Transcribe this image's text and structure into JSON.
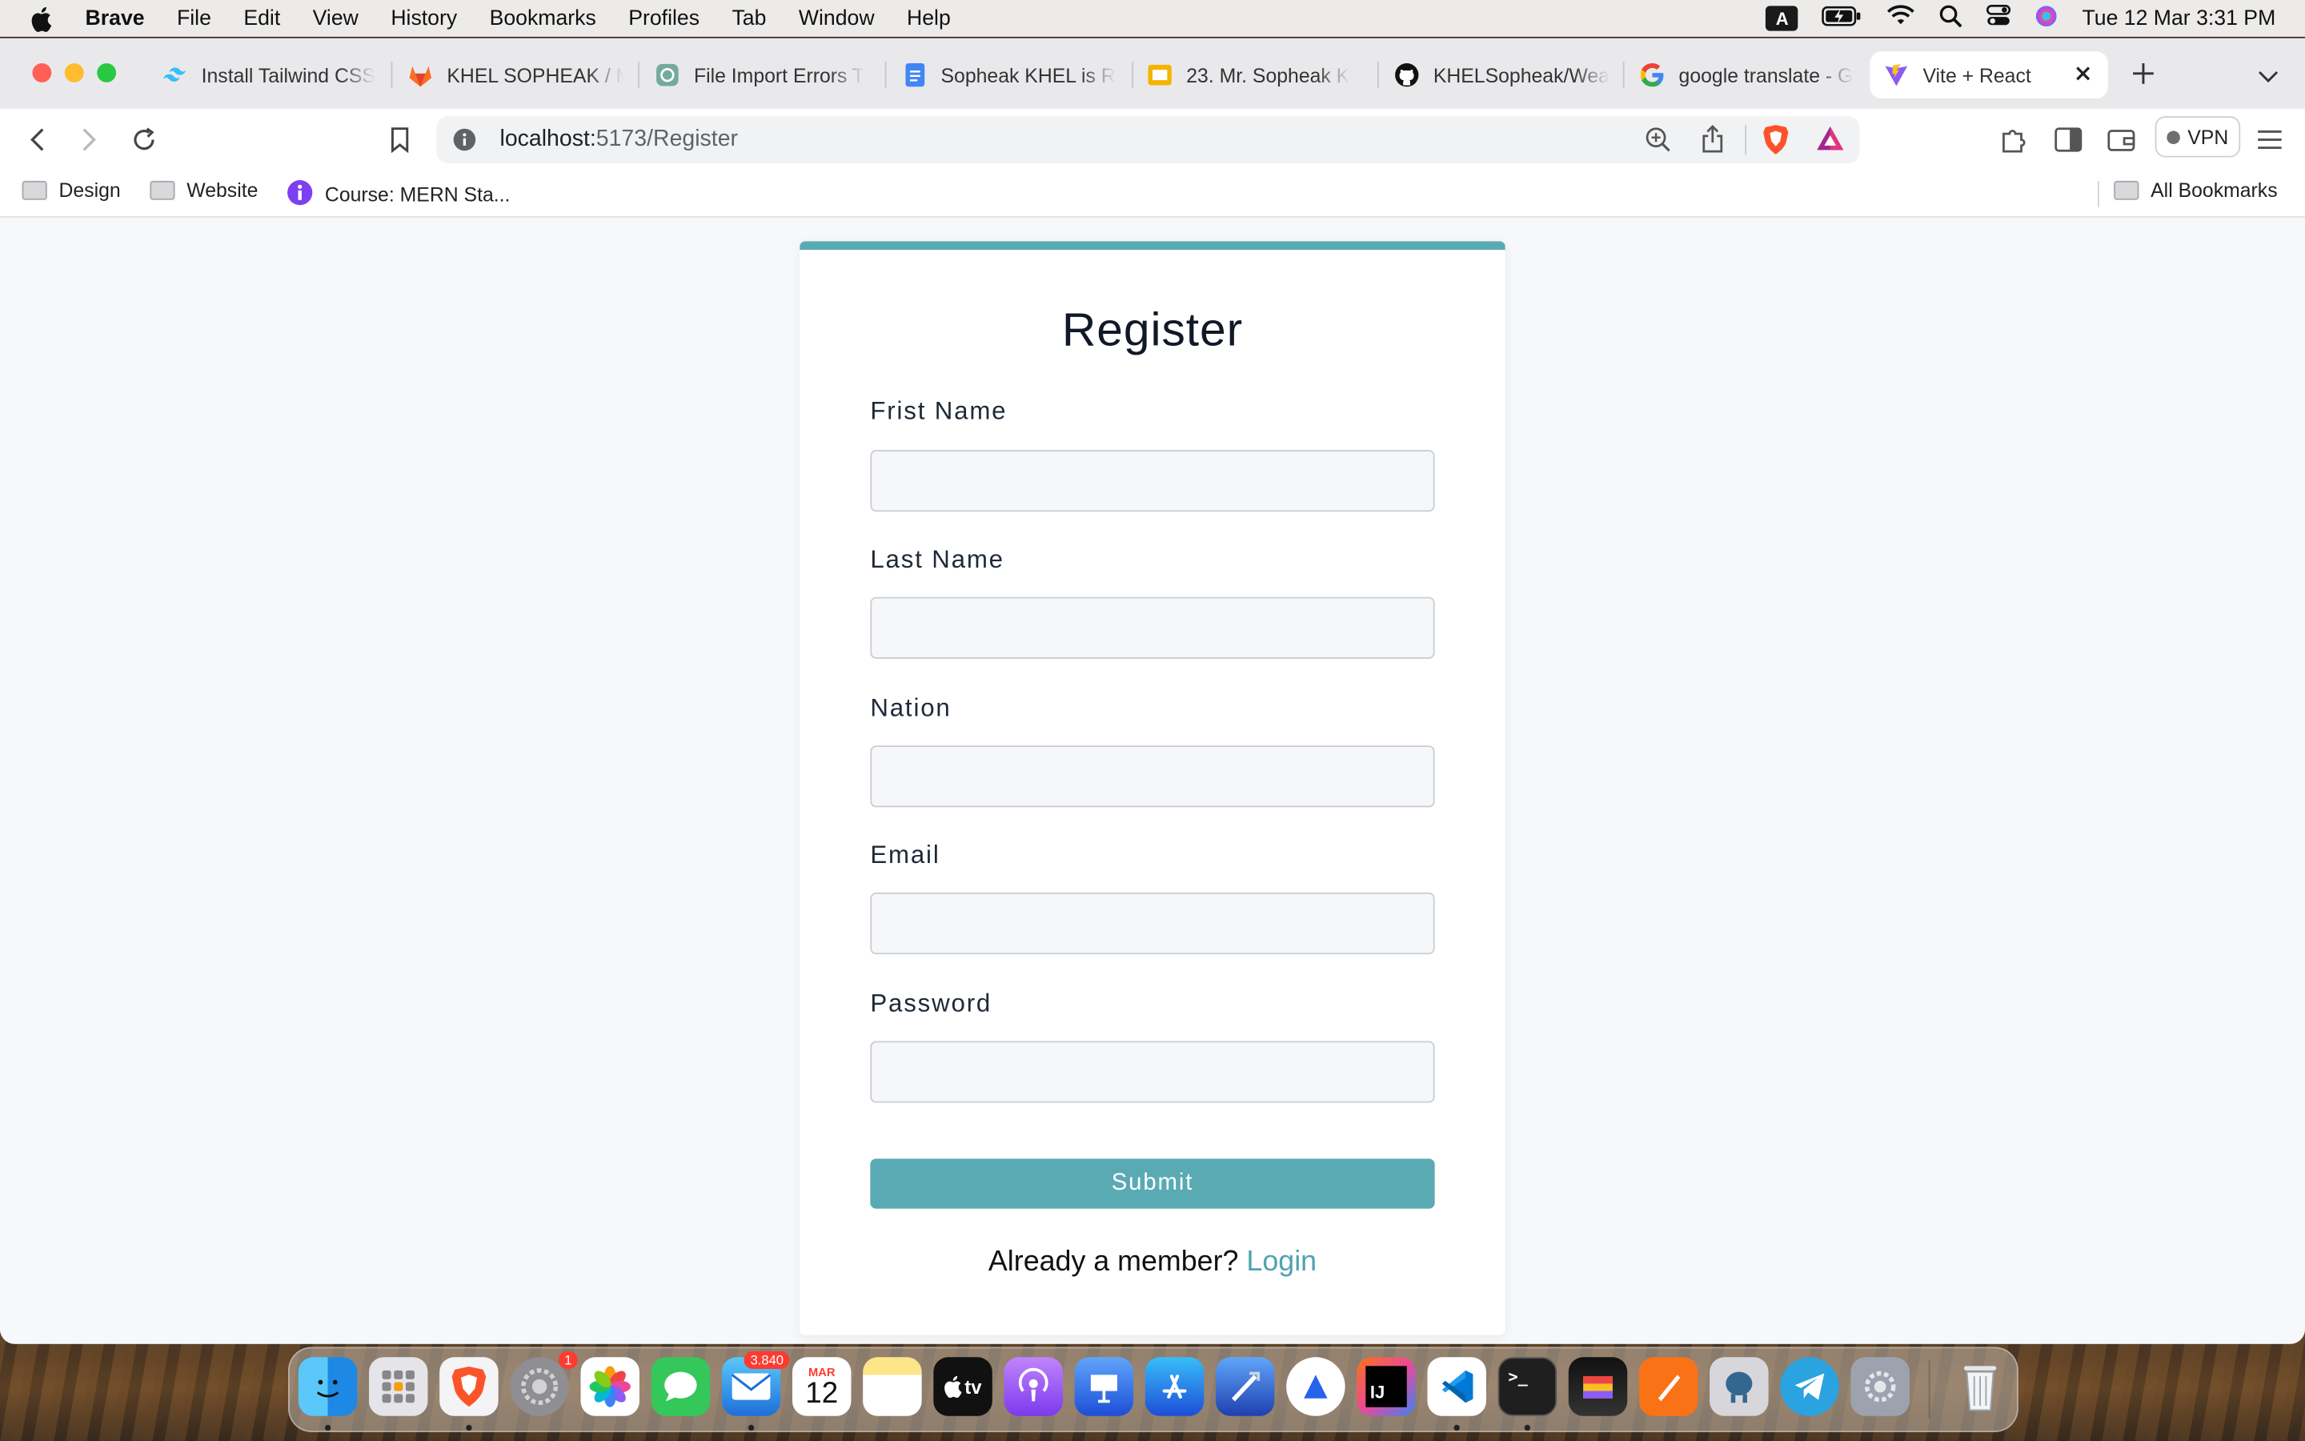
{
  "menubar": {
    "app": "Brave",
    "items": [
      "File",
      "Edit",
      "View",
      "History",
      "Bookmarks",
      "Profiles",
      "Tab",
      "Window",
      "Help"
    ],
    "input_source": "A",
    "clock": "Tue 12 Mar  3:31 PM"
  },
  "tabs": [
    {
      "title": "Install Tailwind CSS",
      "icon": "tailwind-icon"
    },
    {
      "title": "KHEL SOPHEAK / M",
      "icon": "gitlab-icon"
    },
    {
      "title": "File Import Errors T",
      "icon": "chatgpt-icon"
    },
    {
      "title": "Sopheak KHEL is R",
      "icon": "google-docs-icon"
    },
    {
      "title": "23. Mr. Sopheak K",
      "icon": "google-slides-icon"
    },
    {
      "title": "KHELSopheak/Wea",
      "icon": "github-icon"
    },
    {
      "title": "google translate - G",
      "icon": "google-icon"
    },
    {
      "title": "Vite + React",
      "icon": "vite-icon",
      "active": true
    }
  ],
  "address": {
    "host": "localhost:",
    "path": "5173/Register"
  },
  "vpn_label": "VPN",
  "bookmarks": [
    {
      "label": "Design",
      "icon": "folder-icon"
    },
    {
      "label": "Website",
      "icon": "folder-icon"
    },
    {
      "label": "Course: MERN Sta...",
      "icon": "course-icon"
    }
  ],
  "all_bookmarks": "All Bookmarks",
  "form": {
    "title": "Register",
    "fields": [
      {
        "label": "Frist Name",
        "value": ""
      },
      {
        "label": "Last Name",
        "value": ""
      },
      {
        "label": "Nation",
        "value": ""
      },
      {
        "label": "Email",
        "value": ""
      },
      {
        "label": "Password",
        "value": ""
      }
    ],
    "submit": "Submit",
    "already_text": "Already a member?",
    "login_link": "Login",
    "accent_color": "#5aaab4"
  },
  "dock": {
    "settings_badge": "1",
    "mail_badge": "3.840",
    "calendar_month": "MAR",
    "calendar_day": "12",
    "tv_label": "tv",
    "intellij_label": "IJ"
  }
}
